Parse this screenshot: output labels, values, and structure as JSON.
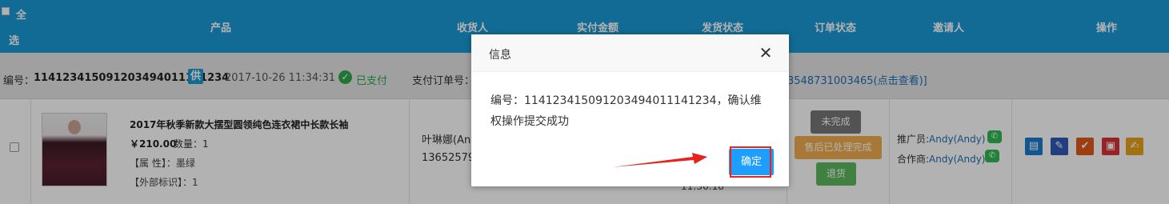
{
  "header": {
    "select_all_1": "全",
    "select_all_2": "选",
    "columns": [
      "产品",
      "收货人",
      "实付金额",
      "发货状态",
      "订单状态",
      "邀请人",
      "操作"
    ]
  },
  "order": {
    "label": "编号：",
    "number": "114123415091203494011141234",
    "supplier_badge": "供",
    "date": "2017-10-26 11:34:31",
    "status": "已支付",
    "pay_order_label": "支付订单号：",
    "pay_link_tail": "3548731003465(点击查看)]"
  },
  "product": {
    "name": "2017年秋季新款大摆型圆领纯色连衣裙中长款长袖",
    "price": "￥210.00",
    "qty": "数量：1",
    "attr": "【属 性】：墨绿",
    "extid": "【外部标识】：1",
    "recipient_name": "叶琳娜(An",
    "recipient_phone": "13652579",
    "time_tail": "11:36:18"
  },
  "status_buttons": {
    "unfinished": "未完成",
    "after_sale": "售后已处理完成",
    "return": "退货"
  },
  "inviter": {
    "promoter_label": "推广员:",
    "promoter_name": "Andy(Andy)",
    "partner_label": "合作商:",
    "partner_name": "Andy(Andy)"
  },
  "dialog": {
    "title": "信息",
    "message": "编号：114123415091203494011141234，确认维权操作提交成功",
    "ok_label": "确定"
  },
  "colors": {
    "header_bg": "#1a9ad6",
    "paid_green": "#2ea84d",
    "ok_blue": "#1e9fff",
    "highlight_red": "#e8231f"
  },
  "icons": {
    "check": "✓",
    "close": "✕",
    "wechat": "wechat-icon"
  }
}
